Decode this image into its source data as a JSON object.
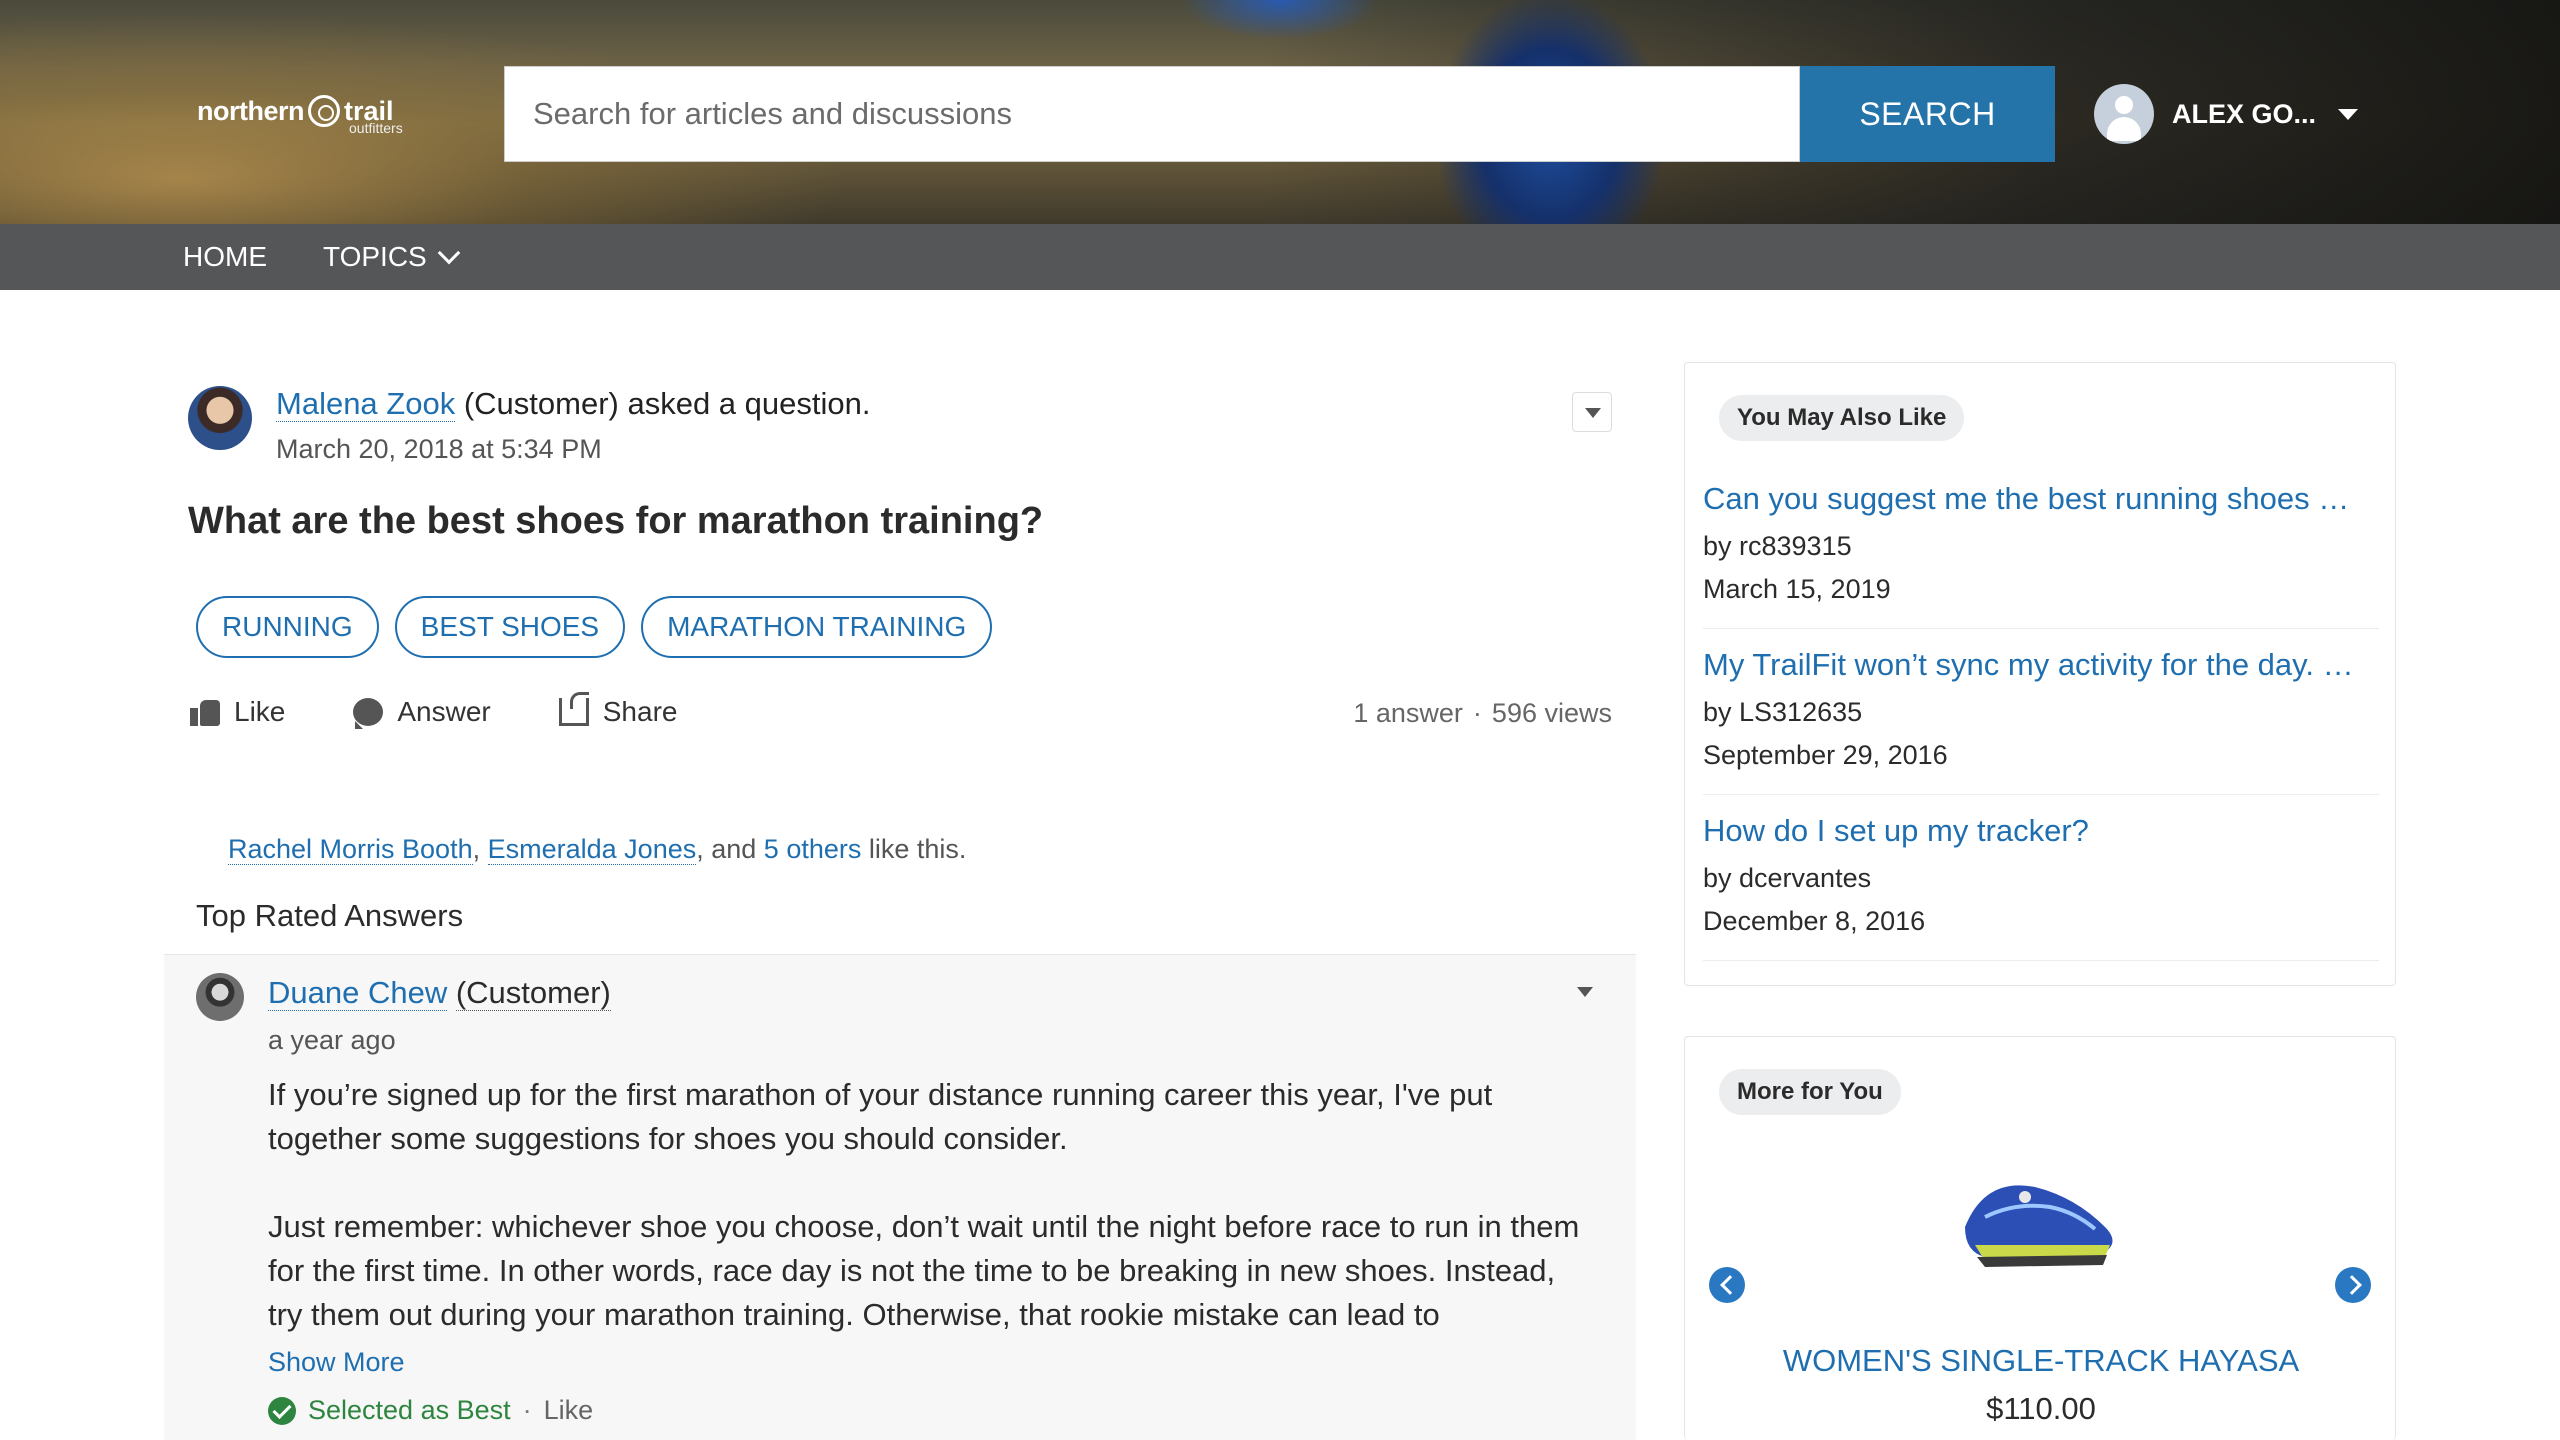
{
  "header": {
    "logo_text_1": "northern",
    "logo_text_2": "trail",
    "logo_sub": "outfitters",
    "search_placeholder": "Search for articles and discussions",
    "search_button": "SEARCH",
    "user_name": "ALEX GO..."
  },
  "nav": {
    "home": "HOME",
    "topics": "TOPICS"
  },
  "question": {
    "author": "Malena Zook",
    "role": "(Customer) asked a question.",
    "date": "March 20, 2018 at 5:34 PM",
    "title": "What are the best shoes for marathon training?",
    "tags": [
      "RUNNING",
      "BEST SHOES",
      "MARATHON TRAINING"
    ],
    "actions": {
      "like": "Like",
      "answer": "Answer",
      "share": "Share"
    },
    "answers": "1 answer",
    "sep": "·",
    "views": "596 views",
    "likers": {
      "name1": "Rachel Morris Booth",
      "name2": "Esmeralda Jones",
      "and": ", and ",
      "others": "5 others",
      "suffix": " like this.",
      "comma": ", "
    }
  },
  "answers_section": {
    "heading": "Top Rated Answers",
    "answer": {
      "author": "Duane Chew",
      "role": "(Customer)",
      "time": "a year ago",
      "para1": "If you’re signed up for the first marathon of your distance running career this year, I've put together some suggestions for shoes you should consider.",
      "para2": "Just remember: whichever shoe you choose, don’t wait until the night before race to run in them for the first time. In other words, race day is not the time to be breaking in new shoes. Instead, try them out during your marathon training. Otherwise, that rookie mistake can lead to",
      "show_more": "Show More",
      "best": "Selected as Best",
      "dot": "·",
      "like": "Like"
    }
  },
  "sidebar": {
    "also_like": {
      "heading": "You May Also Like",
      "items": [
        {
          "title": "Can you suggest me the best running shoes …",
          "by": "by rc839315",
          "date": "March 15, 2019"
        },
        {
          "title": "My TrailFit won’t sync my activity for the day. …",
          "by": "by LS312635",
          "date": "September 29, 2016"
        },
        {
          "title": "How do I set up my tracker?",
          "by": "by dcervantes",
          "date": "December 8, 2016"
        }
      ]
    },
    "more_for_you": {
      "heading": "More for You",
      "product_name": "WOMEN'S SINGLE-TRACK HAYASA",
      "price": "$110.00"
    }
  },
  "colors": {
    "accent": "#2574a9",
    "link": "#1f6fb0",
    "success": "#2e8540"
  }
}
